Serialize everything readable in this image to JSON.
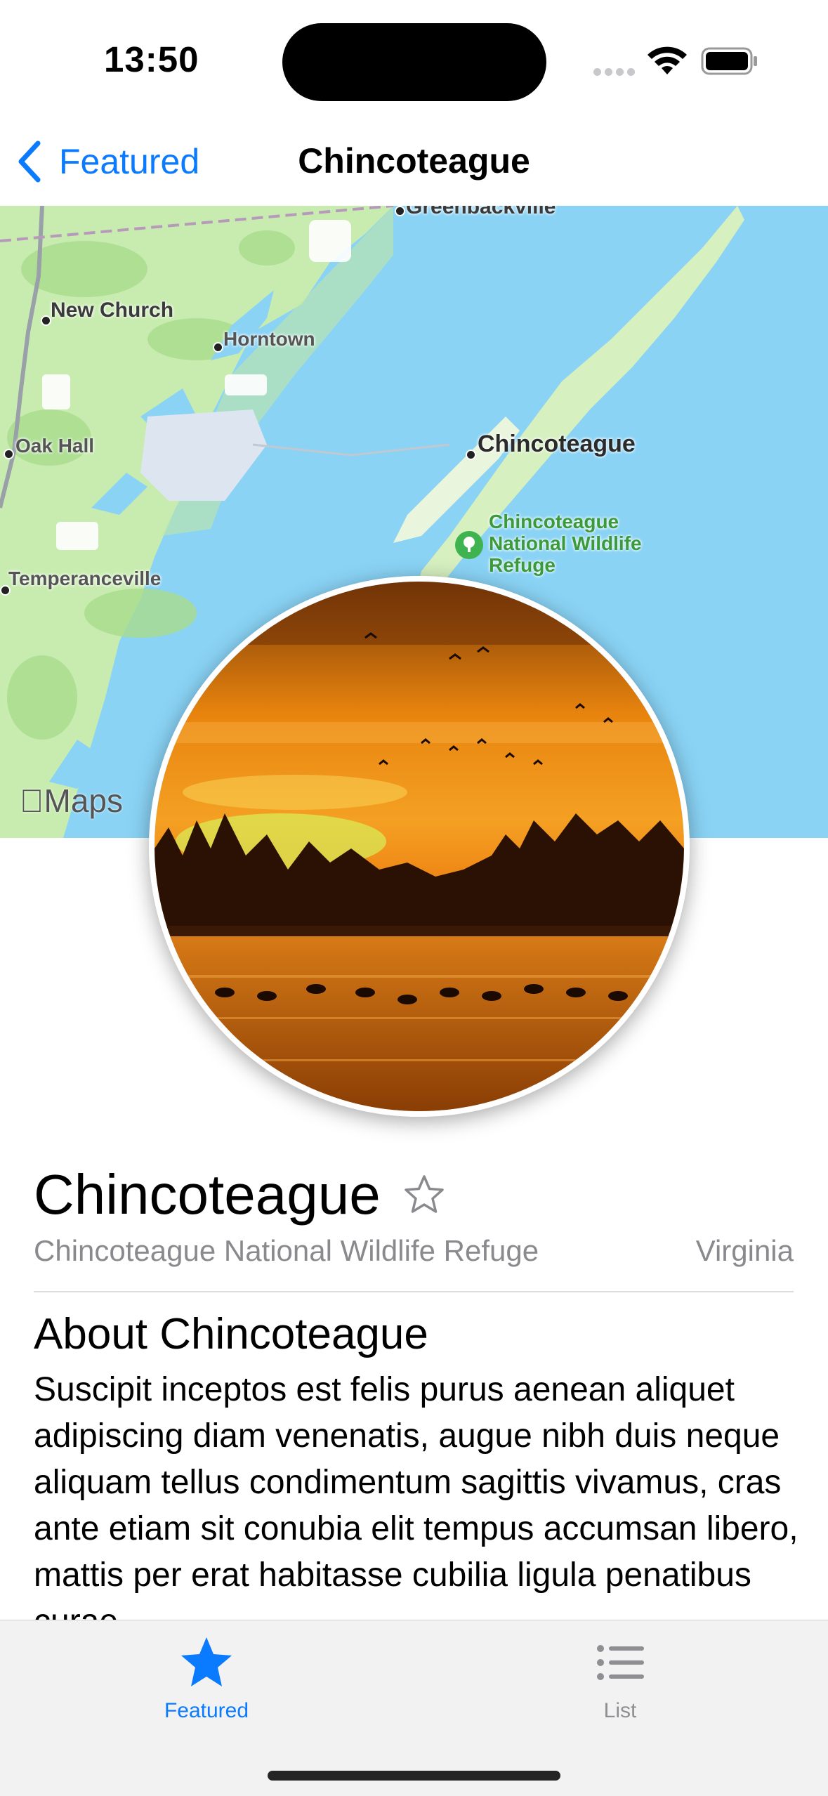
{
  "status": {
    "time": "13:50"
  },
  "nav": {
    "back_label": "Featured",
    "title": "Chincoteague"
  },
  "map": {
    "labels": {
      "greenbackville": "Greenbackville",
      "new_church": "New Church",
      "horntown": "Horntown",
      "oak_hall": "Oak Hall",
      "chincoteague": "Chincoteague",
      "temperanceville": "Temperanceville",
      "refuge": "Chincoteague National Wildlife Refuge"
    },
    "attribution": "Maps"
  },
  "detail": {
    "title": "Chincoteague",
    "park": "Chincoteague National Wildlife Refuge",
    "state": "Virginia",
    "about_title": "About Chincoteague",
    "about_text": "Suscipit inceptos est felis purus aenean aliquet adipiscing diam venenatis, augue nibh duis neque aliquam tellus condimentum sagittis vivamus, cras ante etiam sit conubia elit tempus accumsan libero, mattis per erat habitasse cubilia ligula penatibus curae."
  },
  "tabs": [
    {
      "label": "Featured",
      "icon": "star-fill-icon",
      "selected": true
    },
    {
      "label": "List",
      "icon": "list-icon",
      "selected": false
    }
  ],
  "colors": {
    "accent": "#0a7aff",
    "water": "#8ad3f5",
    "land": "#c8ecb0",
    "poi": "#3fb34f"
  }
}
